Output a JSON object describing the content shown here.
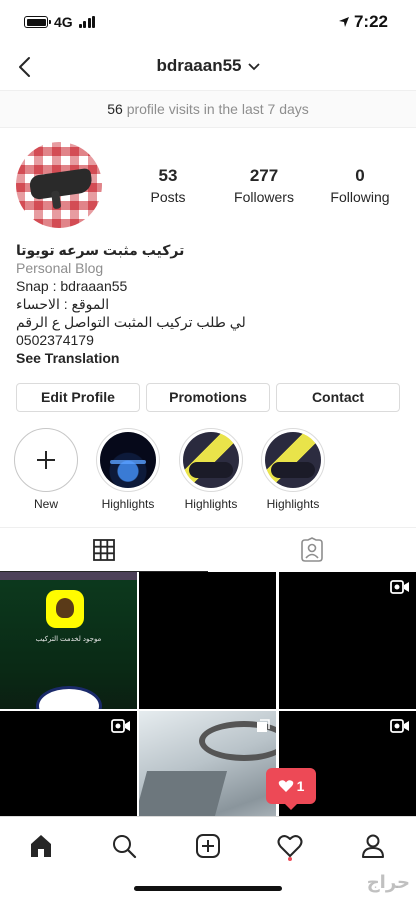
{
  "status": {
    "network": "4G",
    "time": "7:22"
  },
  "header": {
    "username": "bdraaan55"
  },
  "visits": {
    "count": "56",
    "text": "profile visits in the last 7 days"
  },
  "stats": [
    {
      "value": "53",
      "label": "Posts"
    },
    {
      "value": "277",
      "label": "Followers"
    },
    {
      "value": "0",
      "label": "Following"
    }
  ],
  "bio": {
    "name": "تركيب مثبت سرعه تويوتا",
    "category": "Personal Blog",
    "lines": [
      "Snap : bdraaan55",
      "الموقع : الاحساء",
      "لي طلب تركيب المثبت التواصل ع الرقم",
      "0502374179"
    ],
    "translate": "See Translation"
  },
  "buttons": {
    "edit": "Edit Profile",
    "promotions": "Promotions",
    "contact": "Contact"
  },
  "highlights": [
    {
      "label": "New"
    },
    {
      "label": "Highlights"
    },
    {
      "label": "Highlights"
    },
    {
      "label": "Highlights"
    }
  ],
  "grid_overlay": {
    "caption": "موجود لخدمت التركيب"
  },
  "notification": {
    "likes": "1"
  },
  "watermark": "حراج",
  "colors": {
    "accent": "#ed4956",
    "text": "#262626",
    "muted": "#8e8e8e",
    "border": "#dbdbdb"
  },
  "icons": {
    "back": "chevron-left-icon",
    "username_dropdown": "chevron-down-icon",
    "new_highlight": "plus-icon",
    "grid_tab": "grid-icon",
    "tagged_tab": "tagged-person-icon",
    "video": "video-camera-icon",
    "home": "home-icon",
    "search": "search-icon",
    "create": "plus-square-icon",
    "activity": "heart-icon",
    "profile": "person-icon"
  }
}
